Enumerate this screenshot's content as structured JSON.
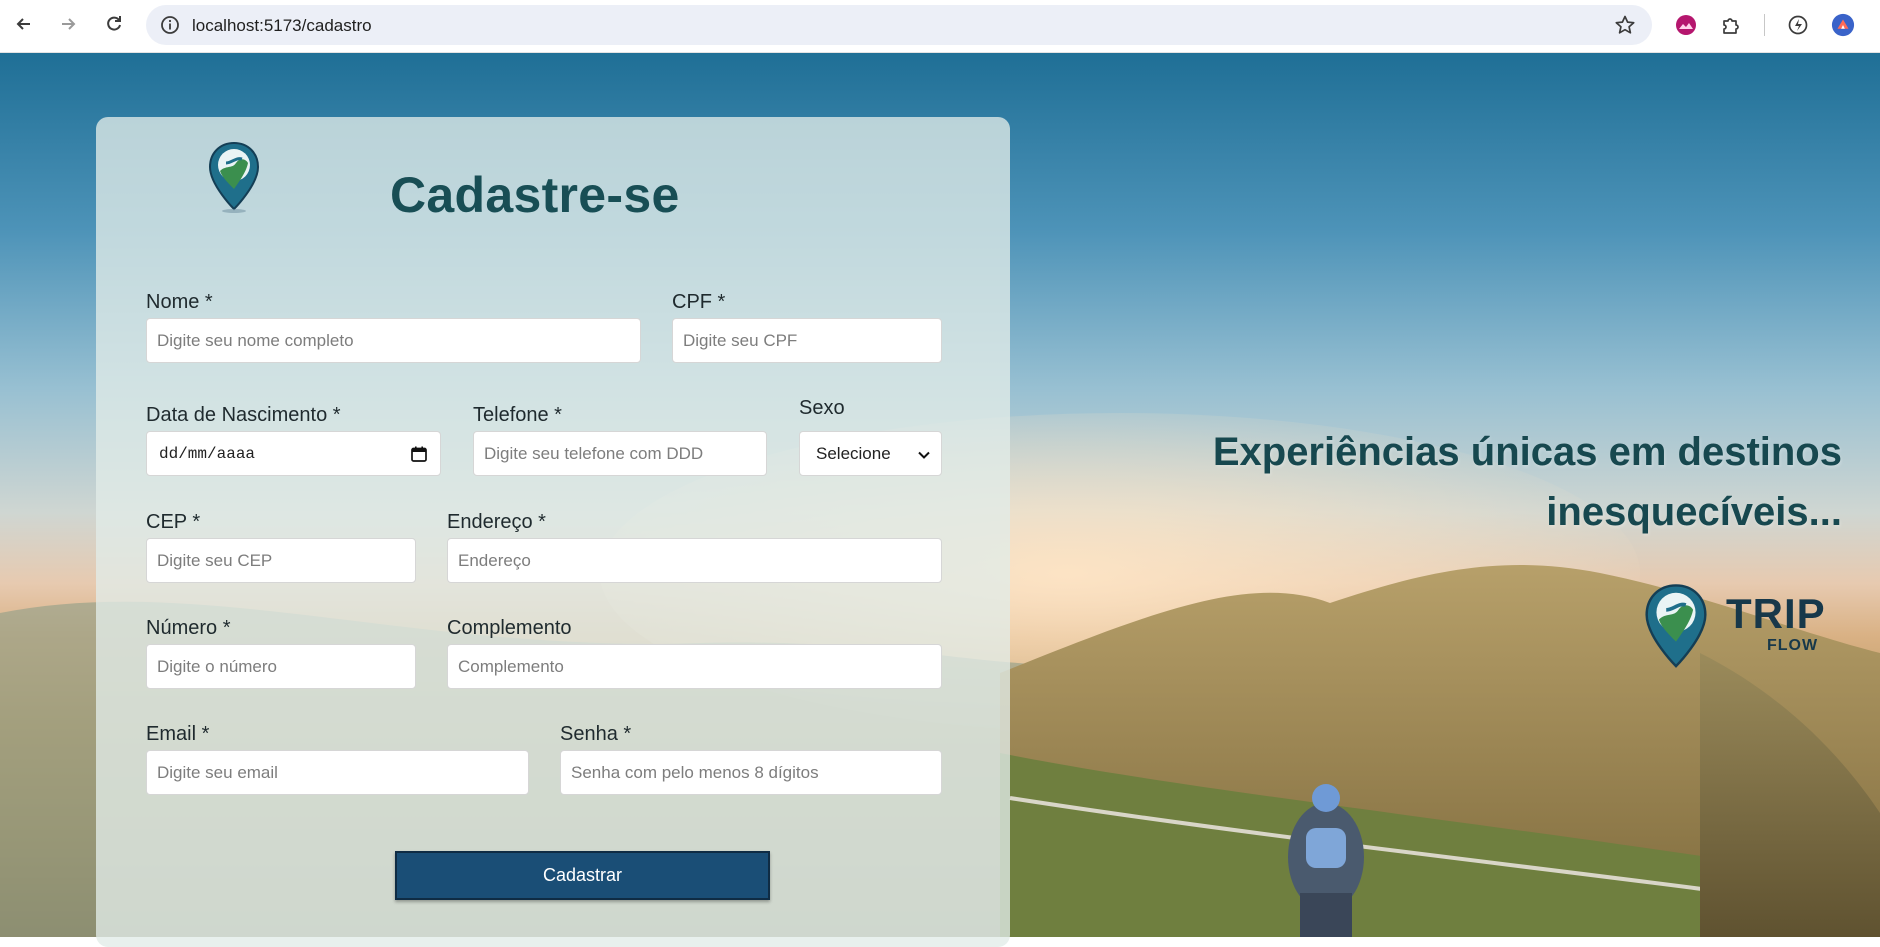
{
  "browser": {
    "url": "localhost:5173/cadastro"
  },
  "form": {
    "title": "Cadastre-se",
    "nome": {
      "label": "Nome *",
      "placeholder": "Digite seu nome completo"
    },
    "cpf": {
      "label": "CPF *",
      "placeholder": "Digite seu CPF"
    },
    "nascimento": {
      "label": "Data de Nascimento *",
      "value": "dd/mm/aaaa"
    },
    "telefone": {
      "label": "Telefone *",
      "placeholder": "Digite seu telefone com DDD"
    },
    "sexo": {
      "label": "Sexo",
      "selected": "Selecione"
    },
    "cep": {
      "label": "CEP *",
      "placeholder": "Digite seu CEP"
    },
    "endereco": {
      "label": "Endereço *",
      "placeholder": "Endereço"
    },
    "numero": {
      "label": "Número *",
      "placeholder": "Digite o número"
    },
    "complemento": {
      "label": "Complemento",
      "placeholder": "Complemento"
    },
    "email": {
      "label": "Email *",
      "placeholder": "Digite seu email"
    },
    "senha": {
      "label": "Senha *",
      "placeholder": "Senha com pelo menos 8 dígitos"
    },
    "submit_label": "Cadastrar"
  },
  "hero": {
    "tagline_line1": "Experiências únicas em destinos",
    "tagline_line2": "inesquecíveis...",
    "brand_trip": "TRIP",
    "brand_flow": "FLOW"
  },
  "colors": {
    "title": "#184e55",
    "button": "#1a4e76",
    "tagline": "#17484f"
  }
}
